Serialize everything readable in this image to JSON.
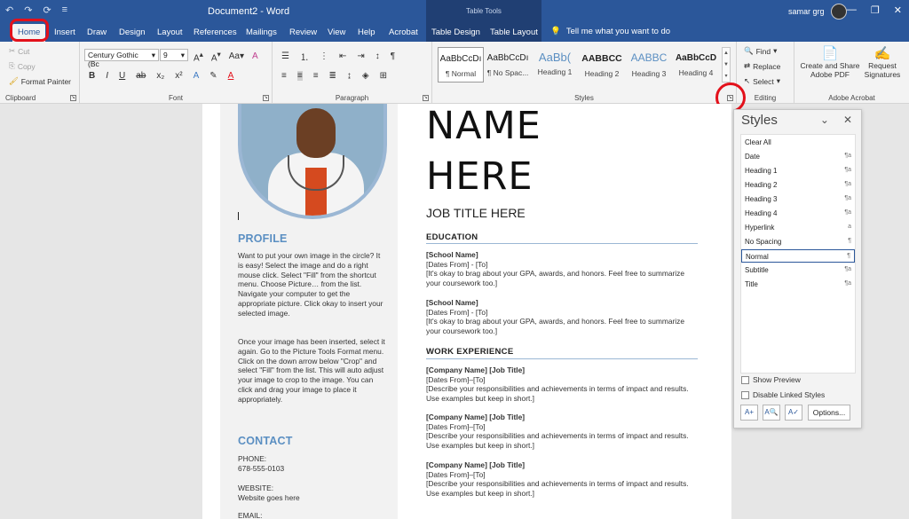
{
  "titlebar": {
    "doc_title": "Document2 - Word",
    "context_title": "Table Tools",
    "user_name": "samar grg",
    "quick_access": [
      "↶",
      "↷",
      "⟳",
      "≡"
    ],
    "window_buttons": [
      "—",
      "❐",
      "✕"
    ]
  },
  "tabs": [
    "Home",
    "Insert",
    "Draw",
    "Design",
    "Layout",
    "References",
    "Mailings",
    "Review",
    "View",
    "Help",
    "Acrobat",
    "Table Design",
    "Table Layout"
  ],
  "tell_me": "Tell me what you want to do",
  "ribbon": {
    "clipboard": {
      "cut": "Cut",
      "copy": "Copy",
      "format_painter": "Format Painter",
      "label": "Clipboard"
    },
    "font": {
      "family": "Century Gothic (Bc",
      "size": "9",
      "label": "Font"
    },
    "paragraph": {
      "label": "Paragraph"
    },
    "styles": {
      "label": "Styles",
      "items": [
        {
          "sample": "AaBbCcDı",
          "name": "¶ Normal"
        },
        {
          "sample": "AaBbCcDı",
          "name": "¶ No Spac..."
        },
        {
          "sample": "AaBb(",
          "name": "Heading 1"
        },
        {
          "sample": "AABBCC",
          "name": "Heading 2"
        },
        {
          "sample": "AABBC",
          "name": "Heading 3"
        },
        {
          "sample": "AaBbCcD",
          "name": "Heading 4"
        }
      ]
    },
    "editing": {
      "find": "Find",
      "replace": "Replace",
      "select": "Select",
      "label": "Editing"
    },
    "acrobat": {
      "create_pdf": "Create and Share Adobe PDF",
      "request_sig": "Request Signatures",
      "label": "Adobe Acrobat"
    }
  },
  "resume": {
    "name_line1": "NAME",
    "name_line2": "HERE",
    "job_title": "JOB TITLE HERE",
    "profile_title": "PROFILE",
    "profile_p1": "Want to put your own image in the circle? It is easy! Select the image and do a right mouse click. Select \"Fill\" from the shortcut menu. Choose Picture… from the list. Navigate your computer to get the appropriate picture. Click okay to insert your selected image.",
    "profile_p2": "Once your image has been inserted, select it again. Go to the Picture Tools Format menu. Click on the down arrow below \"Crop\" and select \"Fill\" from the list. This will auto adjust your image to crop to the image. You can click and drag your image to place it appropriately.",
    "contact_title": "CONTACT",
    "phone_label": "PHONE:",
    "phone": "678-555-0103",
    "website_label": "WEBSITE:",
    "website": "Website goes here",
    "email_label": "EMAIL:",
    "education_title": "EDUCATION",
    "education": [
      {
        "school": "[School Name]",
        "dates": "[Dates From] - [To]",
        "desc": "[It's okay to brag about your GPA, awards, and honors. Feel free to summarize your coursework too.]"
      },
      {
        "school": "[School Name]",
        "dates": "[Dates From] - [To]",
        "desc": "[It's okay to brag about your GPA, awards, and honors. Feel free to summarize your coursework too.]"
      }
    ],
    "work_title": "WORK EXPERIENCE",
    "work": [
      {
        "company": "[Company Name]  [Job Title]",
        "dates": "[Dates From]–[To]",
        "desc": "[Describe your responsibilities and achievements in terms of impact and results. Use examples but keep in short.]"
      },
      {
        "company": "[Company Name]  [Job Title]",
        "dates": "[Dates From]–[To]",
        "desc": "[Describe your responsibilities and achievements in terms of impact and results. Use examples but keep in short.]"
      },
      {
        "company": "[Company Name]  [Job Title]",
        "dates": "[Dates From]–[To]",
        "desc": "[Describe your responsibilities and achievements in terms of impact and results. Use examples but keep in short.]"
      }
    ]
  },
  "styles_pane": {
    "title": "Styles",
    "list": [
      {
        "name": "Clear All",
        "mark": ""
      },
      {
        "name": "Date",
        "mark": "¶a"
      },
      {
        "name": "Heading 1",
        "mark": "¶a"
      },
      {
        "name": "Heading 2",
        "mark": "¶a"
      },
      {
        "name": "Heading 3",
        "mark": "¶a"
      },
      {
        "name": "Heading 4",
        "mark": "¶a"
      },
      {
        "name": "Hyperlink",
        "mark": "a"
      },
      {
        "name": "No Spacing",
        "mark": "¶"
      },
      {
        "name": "Normal",
        "mark": "¶"
      },
      {
        "name": "Subtitle",
        "mark": "¶a"
      },
      {
        "name": "Title",
        "mark": "¶a"
      }
    ],
    "selected": "Normal",
    "show_preview": "Show Preview",
    "disable_linked": "Disable Linked Styles",
    "options": "Options..."
  },
  "colors": {
    "accent": "#2b579a",
    "resume_blue": "#5b8fc2",
    "highlight_red": "#e3111b"
  }
}
